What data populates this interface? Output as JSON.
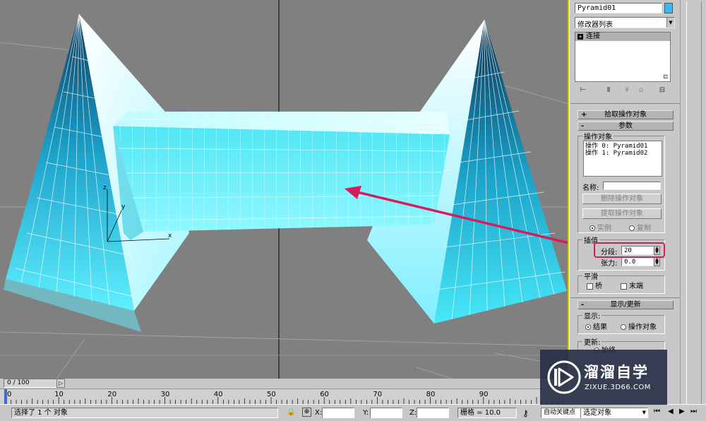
{
  "viewport": {
    "axis_labels": {
      "x": "x",
      "y": "y",
      "z": "z"
    }
  },
  "panel": {
    "object_name": "Pyramid01",
    "object_color": "#38b8ff",
    "modifier_list": "修改器列表",
    "stack_item": "连接",
    "rollout_pick": {
      "sign": "+",
      "label": "拾取操作对象"
    },
    "rollout_params": {
      "sign": "-",
      "label": "参数"
    },
    "operands_group": "操作对象",
    "operands": [
      "操作 0: Pyramid01",
      "操作 1: Pyramid02"
    ],
    "name_label": "名称:",
    "name_value": "",
    "delete_operand": "删除操作对象",
    "extract_operand": "提取操作对象",
    "instance": "实例",
    "copy": "复制",
    "interp_group": "插值",
    "segments_label": "分段:",
    "segments_value": "20",
    "tension_label": "张力:",
    "tension_value": "0.0",
    "smooth_group": "平滑",
    "bridge": "桥",
    "ends": "末端",
    "rollout_display": {
      "sign": "-",
      "label": "显示/更新"
    },
    "display_label": "显示:",
    "result": "结果",
    "operand_opt": "操作对象",
    "update_label": "更新:",
    "always": "始终"
  },
  "timeline": {
    "frame": "0 / 100",
    "ticks": [
      "0",
      "10",
      "20",
      "30",
      "40",
      "50",
      "60",
      "70",
      "80",
      "90"
    ]
  },
  "status": {
    "selection": "选择了 1 个 对象",
    "x_label": "X:",
    "y_label": "Y:",
    "z_label": "Z:",
    "x_value": "",
    "y_value": "",
    "z_value": "",
    "grid": "栅格 = 10.0",
    "autokey": "自动关键点",
    "selected_obj": "选定对象"
  },
  "watermark": {
    "title": "溜溜自学",
    "subtitle": "ZIXUE.3D66.COM"
  },
  "colors": {
    "viewport_bg": "#808080",
    "accent_red": "#d81b5a",
    "mesh_cyan": "#3fe6f5"
  }
}
